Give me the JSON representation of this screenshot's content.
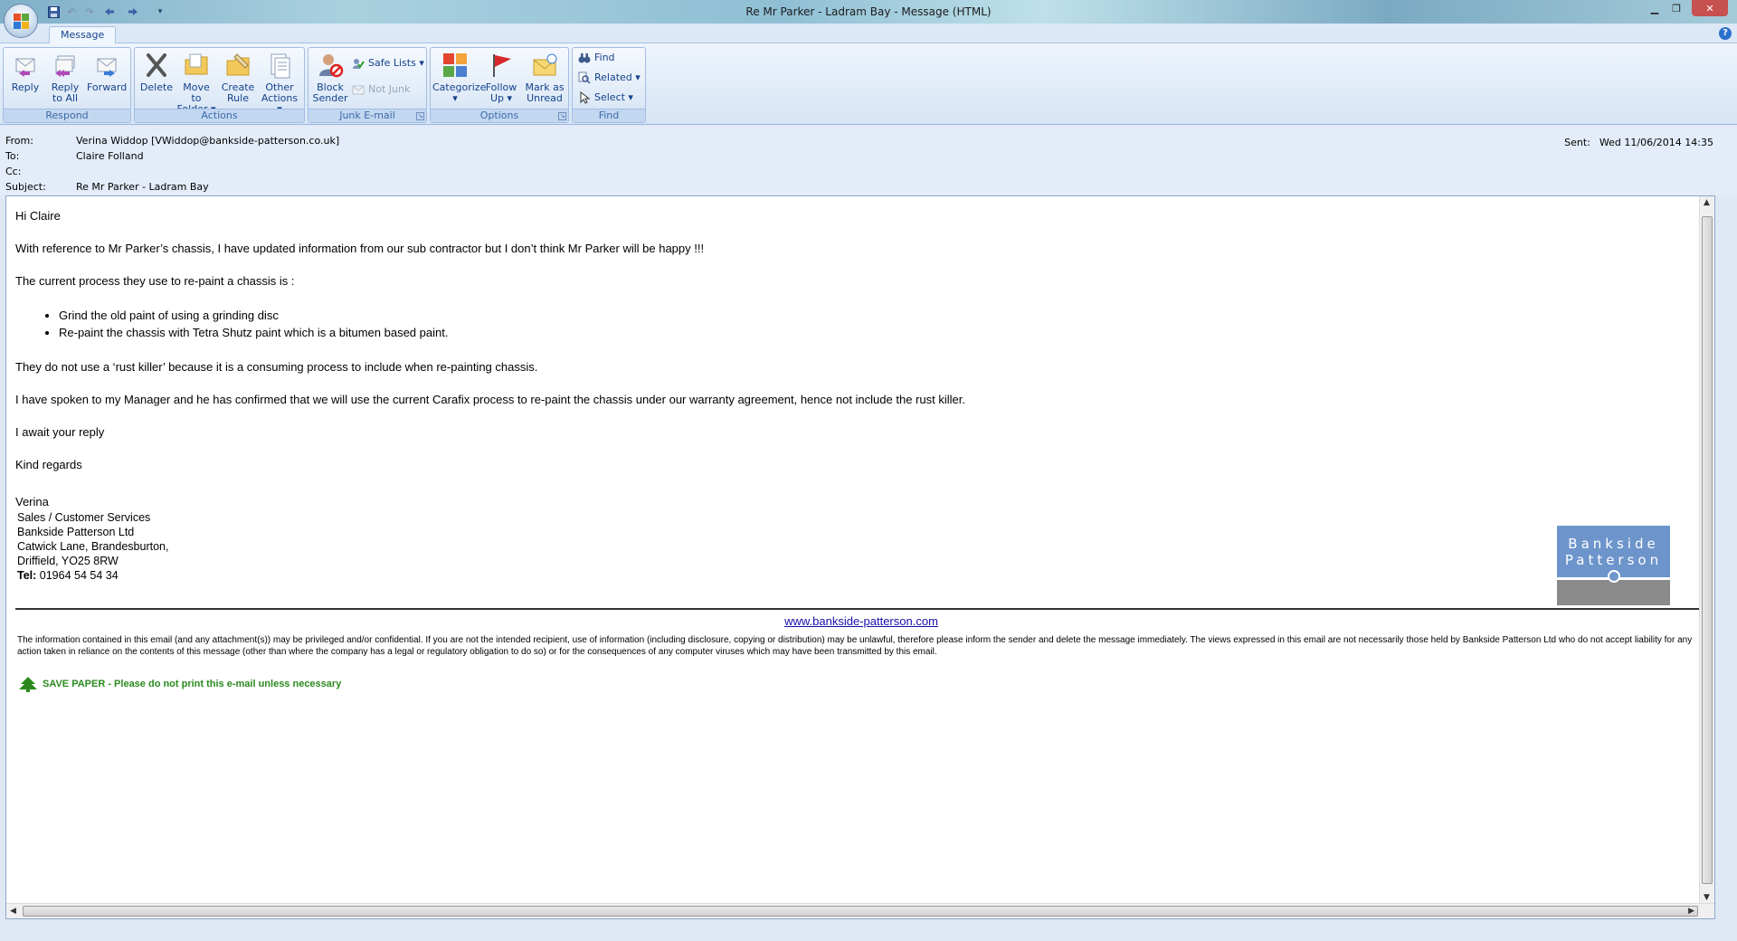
{
  "window": {
    "title": "Re Mr Parker - Ladram Bay - Message (HTML)"
  },
  "tabs": [
    {
      "label": "Message"
    }
  ],
  "ribbon": {
    "respond": {
      "label": "Respond",
      "reply": "Reply",
      "reply_all": "Reply\nto All",
      "forward": "Forward"
    },
    "actions": {
      "label": "Actions",
      "delete": "Delete",
      "move_to_folder": "Move to\nFolder ▾",
      "create_rule": "Create\nRule",
      "other_actions": "Other\nActions ▾"
    },
    "junk": {
      "label": "Junk E-mail",
      "block_sender": "Block\nSender",
      "safe_lists": "Safe Lists ▾",
      "not_junk": "Not Junk"
    },
    "options": {
      "label": "Options",
      "categorize": "Categorize\n▾",
      "follow_up": "Follow\nUp ▾",
      "mark_unread": "Mark as\nUnread"
    },
    "find": {
      "label": "Find",
      "find": "Find",
      "related": "Related ▾",
      "select": "Select ▾"
    }
  },
  "header": {
    "from_label": "From:",
    "from": "Verina Widdop [VWiddop@bankside-patterson.co.uk]",
    "to_label": "To:",
    "to": "Claire Folland",
    "cc_label": "Cc:",
    "cc": "",
    "subject_label": "Subject:",
    "subject": "Re Mr Parker - Ladram Bay",
    "sent_label": "Sent:",
    "sent": "Wed 11/06/2014 14:35"
  },
  "message": {
    "greeting": "Hi Claire",
    "p1": "With reference to Mr Parker’s chassis, I have updated information from our sub contractor but I don’t think Mr Parker will be happy !!!",
    "p2": "The current process they use to re-paint a chassis is :",
    "bullets": [
      "Grind the old paint of using a grinding disc",
      "Re-paint the chassis with Tetra Shutz paint which is a bitumen based paint."
    ],
    "p3": "They do not use a ‘rust killer’ because it is a consuming process to include when re-painting chassis.",
    "p4": "I have spoken to my Manager and he has confirmed that we will use the current Carafix process to re-paint the chassis under our warranty agreement, hence not include the rust killer.",
    "p5": "I await your reply",
    "p6": "Kind regards",
    "signature_name": "Verina",
    "sig_lines": [
      "Sales / Customer Services",
      "Bankside Patterson Ltd",
      "Catwick Lane, Brandesburton,",
      "Driffield, YO25 8RW"
    ],
    "tel_label": "Tel:",
    "tel": "01964 54 54 34",
    "logo_line1": "Bankside",
    "logo_line2": "Patterson",
    "website": "www.bankside-patterson.com",
    "disclaimer": "The information contained in this email (and any attachment(s)) may be privileged and/or confidential. If you are not the intended recipient, use of information (including disclosure, copying or distribution) may be unlawful, therefore please inform the sender and delete the message immediately. The views expressed in this email are not necessarily those held by Bankside Patterson Ltd who do not accept liability for any action taken in reliance on the contents of this message (other than where the company has a legal or regulatory obligation to do so) or for the consequences of any computer viruses which may have been transmitted by this email.",
    "save_paper": "SAVE PAPER - Please do not print this e-mail unless necessary"
  },
  "colors": {
    "brand_blue": "#6d95cb",
    "brand_grey": "#8a8a8a",
    "save_paper_green": "#2b8a1e",
    "ribbon_text": "#15428b"
  }
}
